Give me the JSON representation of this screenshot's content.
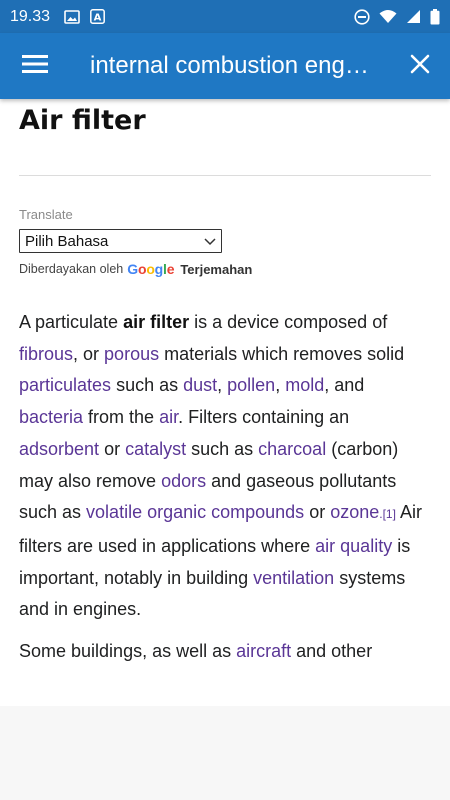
{
  "status_bar": {
    "time": "19.33",
    "left_icons": [
      "image-icon",
      "a-icon"
    ],
    "right_icons": [
      "do-not-disturb-icon",
      "wifi-icon",
      "signal-icon",
      "battery-icon"
    ]
  },
  "app_bar": {
    "title": "internal combustion eng…",
    "menu_icon": "menu-icon",
    "close_icon": "close-icon",
    "color": "#1f78c4"
  },
  "page": {
    "heading": "Air filter",
    "translate": {
      "label": "Translate",
      "select_value": "Pilih Bahasa",
      "powered_by": "Diberdayakan oleh",
      "google": [
        "G",
        "o",
        "o",
        "g",
        "l",
        "e"
      ],
      "link": "Terjemahan"
    },
    "paragraph1": {
      "t1": " A particulate ",
      "b1": "air filter",
      "t2": " is a device composed of ",
      "l1": "fibrous",
      "t3": ", or ",
      "l2": "porous",
      "t4": " materials which removes solid ",
      "l3": "particulates",
      "t5": " such as ",
      "l4": "dust",
      "t6": ", ",
      "l5": "pollen",
      "t7": ", ",
      "l6": "mold",
      "t8": ", and ",
      "l7": "bacteria",
      "t9": " from the ",
      "l8": "air",
      "t10": ". Filters containing an ",
      "l9": "adsorbent",
      "t11": " or ",
      "l10": "catalyst",
      "t12": " such as ",
      "l11": "charcoal",
      "t13": " (carbon) may also remove ",
      "l12": "odors",
      "t14": " and gaseous pollutants such as ",
      "l13": "volatile organic compounds",
      "t15": " or ",
      "l14": "ozone",
      "l15": ".[1]",
      "t16": " Air filters are used in applications where ",
      "l16": "air quality",
      "t17": " is important, notably in building ",
      "l17": "ventilation",
      "t18": " systems and in engines."
    },
    "paragraph2": {
      "t1": "Some buildings, as well as ",
      "l1": "aircraft",
      "t2": " and other"
    }
  },
  "colors": {
    "status_bar": "#1f6fb5",
    "link": "#5a3696"
  }
}
